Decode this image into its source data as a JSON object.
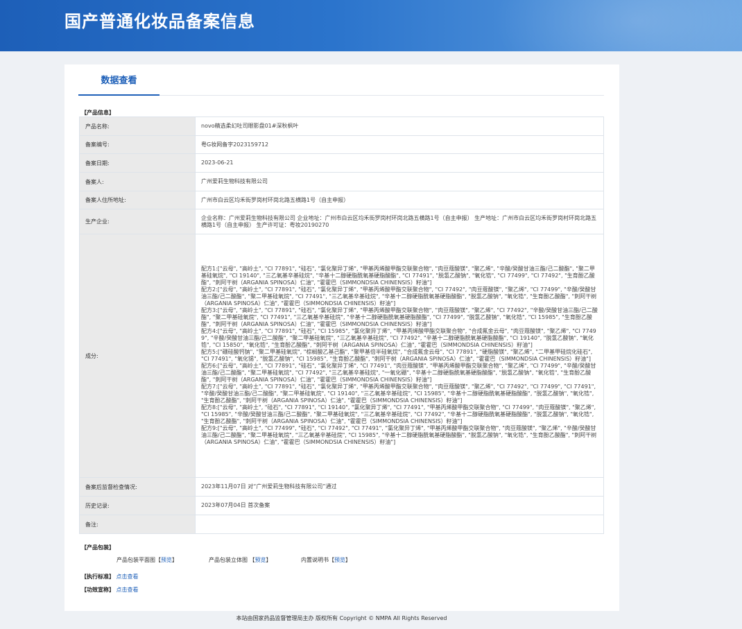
{
  "header": {
    "title": "国产普通化妆品备案信息"
  },
  "tabs": [
    {
      "label": "数据查看"
    }
  ],
  "product_section": {
    "title": "【产品信息】"
  },
  "rows": {
    "name": {
      "label": "产品名称:",
      "value": "novo精选柔幻吐司眼影盘01#深秋枫叶"
    },
    "record_no": {
      "label": "备案编号:",
      "value": "粤G妆网备字2023159712"
    },
    "record_date": {
      "label": "备案日期:",
      "value": "2023-06-21"
    },
    "registrant": {
      "label": "备案人:",
      "value": "广州爱莉生物科技有限公司"
    },
    "address": {
      "label": "备案人住所地址:",
      "value": "广州市白云区均禾街罗岗村环岗北路五横路1号（自主申报）"
    },
    "manufacturer": {
      "label": "生产企业:",
      "value": "企业名称：广州爱莉生物科技有限公司 企业地址：广州市白云区均禾街罗岗村环岗北路五横路1号（自主申报） 生产地址：广州市白云区均禾街罗岗村环岗北路五横路1号（自主申报） 生产许可证：粤妆20190270"
    },
    "ingredients": {
      "label": "成分:",
      "formulas": [
        "配方1:[\"云母\", \"高岭土\", \"CI 77891\", \"硅石\", \"氯化聚异丁烯\", \"甲基丙烯酸甲酯交联聚合物\", \"肉豆蔻酸镁\", \"聚乙烯\", \"辛酸/癸酸甘油三酯/己二酸酯\", \"聚二甲基硅氧烷\", \"CI 19140\", \"三乙氧基辛基硅烷\", \"辛基十二醇硬脂酰氧基硬脂酸酯\", \"CI 77491\", \"脱氢乙酸钠\", \"氧化锆\", \"CI 77499\", \"CI 77492\", \"生育酚乙酸酯\", \"刺阿干树（ARGANIA SPINOSA）仁油\", \"霍霍巴（SIMMONDSIA CHINENSIS）籽油\"]",
        "配方2:[\"云母\", \"高岭土\", \"CI 77891\", \"硅石\", \"氯化聚异丁烯\", \"甲基丙烯酸甲酯交联聚合物\", \"CI 77492\", \"肉豆蔻酸镁\", \"聚乙烯\", \"CI 77499\", \"辛酸/癸酸甘油三酯/己二酸酯\", \"聚二甲基硅氧烷\", \"CI 77491\", \"三乙氧基辛基硅烷\", \"辛基十二醇硬脂酰氧基硬脂酸酯\", \"脱氢乙酸钠\", \"氧化锆\", \"生育酚乙酸酯\", \"刺阿干树（ARGANIA SPINOSA）仁油\", \"霍霍巴（SIMMONDSIA CHINENSIS）籽油\"]",
        "配方3:[\"云母\", \"高岭土\", \"CI 77891\", \"硅石\", \"氯化聚异丁烯\", \"甲基丙烯酸甲酯交联聚合物\", \"肉豆蔻酸镁\", \"聚乙烯\", \"CI 77492\", \"辛酸/癸酸甘油三酯/己二酸酯\", \"聚二甲基硅氧烷\", \"CI 77491\", \"三乙氧基辛基硅烷\", \"辛基十二醇硬脂酰氧基硬脂酸酯\", \"CI 77499\", \"脱氢乙酸钠\", \"氧化锆\", \"CI 15985\", \"生育酚乙酸酯\", \"刺阿干树（ARGANIA SPINOSA）仁油\", \"霍霍巴（SIMMONDSIA CHINENSIS）籽油\"]",
        "配方4:[\"云母\", \"高岭土\", \"CI 77891\", \"硅石\", \"CI 15985\", \"氯化聚异丁烯\", \"甲基丙烯酸甲酯交联聚合物\", \"合成氟金云母\", \"肉豆蔻酸镁\", \"聚乙烯\", \"CI 77499\", \"辛酸/癸酸甘油三酯/己二酸酯\", \"聚二甲基硅氧烷\", \"三乙氧基辛基硅烷\", \"CI 77492\", \"辛基十二醇硬脂酰氧基硬脂酸酯\", \"CI 19140\", \"脱氢乙酸钠\", \"氧化锆\", \"CI 15850\", \"氧化锆\", \"生育酚乙酸酯\", \"刺阿干树（ARGANIA SPINOSA）仁油\", \"霍霍巴（SIMMONDSIA CHINENSIS）籽油\"]",
        "配方5:[\"硼硅酸钙钠\", \"聚二甲基硅氧烷\", \"棕榈酸乙基己酯\", \"聚甲基倍半硅氧烷\", \"合成氟金云母\", \"CI 77891\", \"硬脂酸镁\", \"聚乙烯\", \"二甲基甲硅烷化硅石\", \"CI 77491\", \"氧化锡\", \"脱氢乙酸钠\", \"CI 15985\", \"生育酚乙酸酯\", \"刺阿干树（ARGANIA SPINOSA）仁油\", \"霍霍巴（SIMMONDSIA CHINENSIS）籽油\"]",
        "配方6:[\"云母\", \"高岭土\", \"CI 77891\", \"硅石\", \"氯化聚异丁烯\", \"CI 77491\", \"肉豆蔻酸镁\", \"甲基丙烯酸甲酯交联聚合物\", \"聚乙烯\", \"CI 77499\", \"辛酸/癸酸甘油三酯/己二酸酯\", \"聚二甲基硅氧烷\", \"CI 77492\", \"三乙氧基辛基硅烷\", \"一氧化硼\", \"辛基十二醇硬脂酰氧基硬脂酸酯\", \"脱氢乙酸钠\", \"氧化锆\", \"生育酚乙酸酯\", \"刺阿干树（ARGANIA SPINOSA）仁油\", \"霍霍巴（SIMMONDSIA CHINENSIS）籽油\"]",
        "配方7:[\"云母\", \"高岭土\", \"CI 77891\", \"硅石\", \"氯化聚异丁烯\", \"甲基丙烯酸甲酯交联聚合物\", \"肉豆蔻酸镁\", \"聚乙烯\", \"CI 77492\", \"CI 77499\", \"CI 77491\", \"辛酸/癸酸甘油三酯/己二酸酯\", \"聚二甲基硅氧烷\", \"CI 19140\", \"三乙氧基辛基硅烷\", \"CI 15985\", \"辛基十二醇硬脂酰氧基硬脂酸酯\", \"脱氢乙酸钠\", \"氧化锆\", \"生育酚乙酸酯\", \"刺阿干树（ARGANIA SPINOSA）仁油\", \"霍霍巴（SIMMONDSIA CHINENSIS）籽油\"]",
        "配方8:[\"云母\", \"高岭土\", \"硅石\", \"CI 77891\", \"CI 19140\", \"氯化聚异丁烯\", \"CI 77491\", \"甲基丙烯酸甲酯交联聚合物\", \"CI 77499\", \"肉豆蔻酸镁\", \"聚乙烯\", \"CI 15985\", \"辛酸/癸酸甘油三酯/己二酸酯\", \"聚二甲基硅氧烷\", \"三乙氧基辛基硅烷\", \"CI 77492\", \"辛基十二醇硬脂酰氧基硬脂酸酯\", \"脱氢乙酸钠\", \"氧化锆\", \"生育酚乙酸酯\", \"刺阿干树（ARGANIA SPINOSA）仁油\", \"霍霍巴（SIMMONDSIA CHINENSIS）籽油\"]",
        "配方9:[\"云母\", \"高岭土\", \"CI 77499\", \"硅石\", \"CI 77492\", \"CI 77491\", \"氯化聚异丁烯\", \"甲基丙烯酸甲酯交联聚合物\", \"肉豆蔻酸镁\", \"聚乙烯\", \"辛酸/癸酸甘油三酯/己二酸酯\", \"聚二甲基硅氧烷\", \"三乙氧基辛基硅烷\", \"CI 15985\", \"辛基十二醇硬脂酰氧基硬脂酸酯\", \"脱氢乙酸钠\", \"氧化锆\", \"生育酚乙酸酯\", \"刺阿干树（ARGANIA SPINOSA）仁油\", \"霍霍巴（SIMMONDSIA CHINENSIS）籽油\"]"
      ]
    },
    "inspection": {
      "label": "备案后监督检查情况:",
      "value": "2023年11月07日 对“广州爱莉生物科技有限公司”通过"
    },
    "history": {
      "label": "历史记录:",
      "value": "2023年07月04日 首次备案"
    },
    "remarks": {
      "label": "备注:",
      "value": ""
    }
  },
  "packaging": {
    "title": "【产品包装】",
    "items": [
      {
        "label": "产品包装平面图",
        "link": "预览"
      },
      {
        "label": "产品包装立体图",
        "link": "预览"
      },
      {
        "label": "内置说明书",
        "link": "预览"
      }
    ]
  },
  "standards": {
    "title": "【执行标准】",
    "link": "点击查看"
  },
  "claims": {
    "title": "【功效宣称】",
    "link": "点击查看"
  },
  "footer": {
    "text": "本站由国家药品监督管理局主办 版权所有 Copyright © NMPA All Rights Reserved"
  }
}
